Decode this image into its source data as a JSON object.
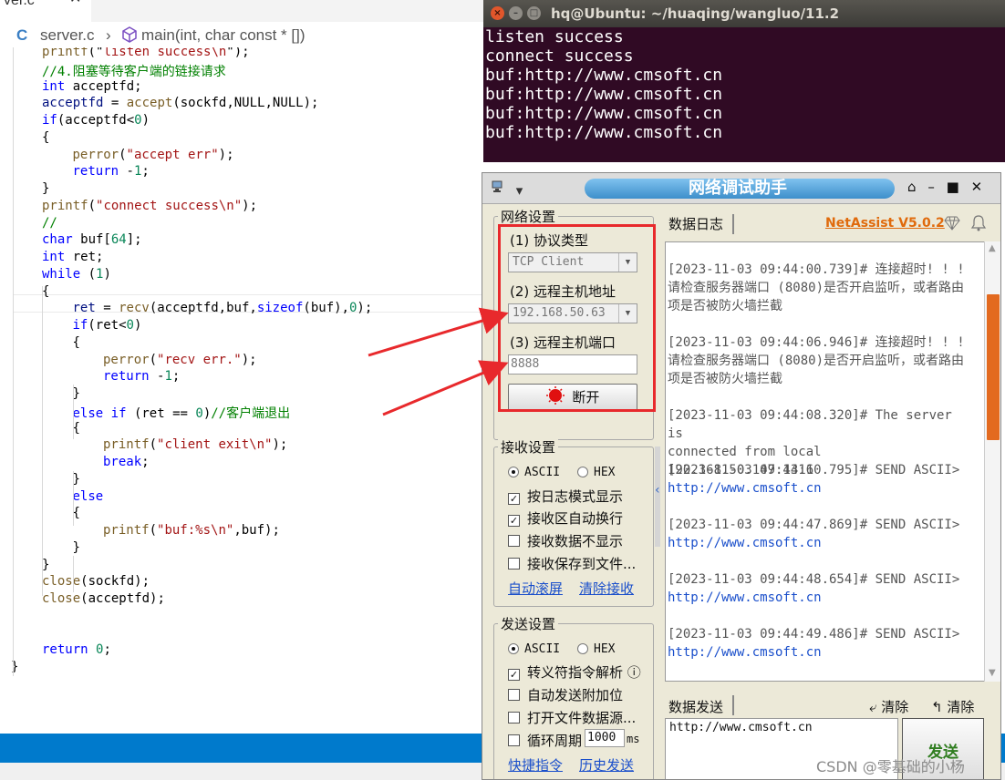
{
  "editor": {
    "tab": {
      "name": "ver.c",
      "close": "✕"
    },
    "breadcrumb": {
      "lang_icon": "C",
      "file": "server.c",
      "sep": "›",
      "symbol_icon": "cube-icon",
      "symbol": "main(int, char const * [])"
    },
    "current_line": 12,
    "lines": [
      {
        "indent": 1,
        "tokens": [
          [
            "fn",
            "printf"
          ],
          [
            "",
            "(\""
          ],
          [
            "str",
            "listen success\\n"
          ],
          [
            "",
            "\");"
          ]
        ]
      },
      {
        "indent": 1,
        "tokens": [
          [
            "cm",
            "//4.阻塞等待客户端的链接请求"
          ]
        ]
      },
      {
        "indent": 1,
        "tokens": [
          [
            "ty",
            "int"
          ],
          [
            "",
            " acceptfd;"
          ]
        ]
      },
      {
        "indent": 1,
        "tokens": [
          [
            "var",
            "acceptfd"
          ],
          [
            "",
            " = "
          ],
          [
            "fn",
            "accept"
          ],
          [
            "",
            "(sockfd,NULL,NULL);"
          ]
        ]
      },
      {
        "indent": 1,
        "tokens": [
          [
            "kw",
            "if"
          ],
          [
            "",
            "(acceptfd<"
          ],
          [
            "num",
            "0"
          ],
          [
            "",
            ")"
          ]
        ]
      },
      {
        "indent": 1,
        "tokens": [
          [
            "",
            "{"
          ]
        ]
      },
      {
        "indent": 2,
        "tokens": [
          [
            "fn",
            "perror"
          ],
          [
            "",
            "("
          ],
          [
            "str",
            "\"accept err\""
          ],
          [
            "",
            ");"
          ]
        ]
      },
      {
        "indent": 2,
        "tokens": [
          [
            "kw",
            "return"
          ],
          [
            "",
            " -"
          ],
          [
            "num",
            "1"
          ],
          [
            "",
            ";"
          ]
        ]
      },
      {
        "indent": 1,
        "tokens": [
          [
            "",
            "}"
          ]
        ]
      },
      {
        "indent": 1,
        "tokens": [
          [
            "fn",
            "printf"
          ],
          [
            "",
            "("
          ],
          [
            "str",
            "\"connect success\\n\""
          ],
          [
            "",
            ");"
          ]
        ]
      },
      {
        "indent": 1,
        "tokens": [
          [
            "cm",
            "//"
          ]
        ]
      },
      {
        "indent": 1,
        "tokens": [
          [
            "ty",
            "char"
          ],
          [
            "",
            " buf["
          ],
          [
            "num",
            "64"
          ],
          [
            "",
            "];"
          ]
        ]
      },
      {
        "indent": 1,
        "tokens": [
          [
            "ty",
            "int"
          ],
          [
            "",
            " ret;"
          ]
        ]
      },
      {
        "indent": 1,
        "tokens": [
          [
            "kw",
            "while"
          ],
          [
            "",
            " ("
          ],
          [
            "num",
            "1"
          ],
          [
            "",
            ")"
          ]
        ]
      },
      {
        "indent": 1,
        "tokens": [
          [
            "",
            "{"
          ]
        ]
      },
      {
        "indent": 2,
        "tokens": [
          [
            "var",
            "ret"
          ],
          [
            "",
            " = "
          ],
          [
            "fn",
            "recv"
          ],
          [
            "",
            "(acceptfd,buf,"
          ],
          [
            "kw",
            "sizeof"
          ],
          [
            "",
            "(buf),"
          ],
          [
            "num",
            "0"
          ],
          [
            "",
            ");"
          ]
        ]
      },
      {
        "indent": 2,
        "tokens": [
          [
            "kw",
            "if"
          ],
          [
            "",
            "(ret<"
          ],
          [
            "num",
            "0"
          ],
          [
            "",
            ")"
          ]
        ]
      },
      {
        "indent": 2,
        "tokens": [
          [
            "",
            "{"
          ]
        ]
      },
      {
        "indent": 3,
        "tokens": [
          [
            "fn",
            "perror"
          ],
          [
            "",
            "("
          ],
          [
            "str",
            "\"recv err.\""
          ],
          [
            "",
            ");"
          ]
        ]
      },
      {
        "indent": 3,
        "tokens": [
          [
            "kw",
            "return"
          ],
          [
            "",
            " -"
          ],
          [
            "num",
            "1"
          ],
          [
            "",
            ";"
          ]
        ]
      },
      {
        "indent": 2,
        "tokens": [
          [
            "",
            "}"
          ]
        ]
      },
      {
        "indent": 2,
        "tokens": [
          [
            "kw",
            "else if"
          ],
          [
            "",
            " (ret == "
          ],
          [
            "num",
            "0"
          ],
          [
            "",
            ")"
          ],
          [
            "cm",
            "//客户端退出"
          ]
        ]
      },
      {
        "indent": 2,
        "tokens": [
          [
            "",
            "{"
          ]
        ]
      },
      {
        "indent": 3,
        "tokens": [
          [
            "fn",
            "printf"
          ],
          [
            "",
            "("
          ],
          [
            "str",
            "\"client exit\\n\""
          ],
          [
            "",
            ");"
          ]
        ]
      },
      {
        "indent": 3,
        "tokens": [
          [
            "kw",
            "break"
          ],
          [
            "",
            ";"
          ]
        ]
      },
      {
        "indent": 2,
        "tokens": [
          [
            "",
            "}"
          ]
        ]
      },
      {
        "indent": 2,
        "tokens": [
          [
            "kw",
            "else"
          ]
        ]
      },
      {
        "indent": 2,
        "tokens": [
          [
            "",
            "{"
          ]
        ]
      },
      {
        "indent": 3,
        "tokens": [
          [
            "fn",
            "printf"
          ],
          [
            "",
            "("
          ],
          [
            "str",
            "\"buf:%s\\n\""
          ],
          [
            "",
            ",buf);"
          ]
        ]
      },
      {
        "indent": 2,
        "tokens": [
          [
            "",
            "}"
          ]
        ]
      },
      {
        "indent": 1,
        "tokens": [
          [
            "",
            "}"
          ]
        ]
      },
      {
        "indent": 1,
        "tokens": [
          [
            "fn",
            "close"
          ],
          [
            "",
            "(sockfd);"
          ]
        ]
      },
      {
        "indent": 1,
        "tokens": [
          [
            "fn",
            "close"
          ],
          [
            "",
            "(acceptfd);"
          ]
        ]
      },
      {
        "indent": 0,
        "tokens": []
      },
      {
        "indent": 0,
        "tokens": []
      },
      {
        "indent": 1,
        "tokens": [
          [
            "kw",
            "return"
          ],
          [
            "",
            " "
          ],
          [
            "num",
            "0"
          ],
          [
            "",
            ";"
          ]
        ]
      },
      {
        "indent": 0,
        "tokens": [
          [
            "",
            "}"
          ]
        ]
      }
    ]
  },
  "terminal": {
    "title": "hq@Ubuntu: ~/huaqing/wangluo/11.2",
    "buttons": [
      "×",
      "–",
      "□"
    ],
    "lines": [
      "listen success",
      "connect success",
      "buf:http://www.cmsoft.cn",
      "buf:http://www.cmsoft.cn",
      "buf:http://www.cmsoft.cn",
      "buf:http://www.cmsoft.cn"
    ]
  },
  "netassist": {
    "title": "网络调试助手",
    "menu_icon": "▾",
    "window_buttons": [
      "⌂",
      "–",
      "■",
      "✕"
    ],
    "net_settings": {
      "title": "网络设置",
      "protocol_label": "(1) 协议类型",
      "protocol_value": "TCP Client",
      "host_label": "(2) 远程主机地址",
      "host_value": "192.168.50.63",
      "port_label": "(3) 远程主机端口",
      "port_value": "8888",
      "disconnect_label": "断开"
    },
    "recv_settings": {
      "title": "接收设置",
      "ascii": "ASCII",
      "hex": "HEX",
      "opt_log_mode": "按日志模式显示",
      "opt_auto_wrap": "接收区自动换行",
      "opt_no_display": "接收数据不显示",
      "opt_save_file": "接收保存到文件...",
      "link_autoscroll": "自动滚屏",
      "link_clear": "清除接收"
    },
    "send_settings": {
      "title": "发送设置",
      "ascii": "ASCII",
      "hex": "HEX",
      "opt_escape": "转义符指令解析",
      "info_icon": "ⓘ",
      "opt_append": "自动发送附加位",
      "opt_open_file": "打开文件数据源...",
      "opt_cycle": "循环周期",
      "cycle_value": "1000",
      "cycle_unit": "ms",
      "link_shortcut": "快捷指令",
      "link_history": "历史发送"
    },
    "log": {
      "tab": "数据日志",
      "brand": "NetAssist V5.0.2",
      "entries": [
        {
          "head": "[2023-11-03 09:44:00.739]# 连接超时! ! !",
          "body": "请检查服务器端口 (8080)是否开启监听，或者路由项是否被防火墙拦截",
          "url": ""
        },
        {
          "head": "[2023-11-03 09:44:06.946]# 连接超时! ! !",
          "body": "请检查服务器端口 (8080)是否开启监听，或者路由项是否被防火墙拦截",
          "url": ""
        },
        {
          "head": "[2023-11-03 09:44:08.320]# The server is",
          "body": "connected from local 192.168.50.147:1316",
          "url": ""
        },
        {
          "head": "[2023-11-03 09:44:10.795]# SEND ASCII>",
          "body": "",
          "url": "http://www.cmsoft.cn"
        },
        {
          "head": "[2023-11-03 09:44:47.869]# SEND ASCII>",
          "body": "",
          "url": "http://www.cmsoft.cn"
        },
        {
          "head": "[2023-11-03 09:44:48.654]# SEND ASCII>",
          "body": "",
          "url": "http://www.cmsoft.cn"
        },
        {
          "head": "[2023-11-03 09:44:49.486]# SEND ASCII>",
          "body": "",
          "url": "http://www.cmsoft.cn"
        }
      ]
    },
    "send": {
      "tab": "数据发送",
      "clear1": "清除",
      "clear2": "清除",
      "input_value": "http://www.cmsoft.cn",
      "send_label": "发送"
    },
    "colors": {
      "highlight_box": "#e8292c",
      "brand": "#e06a0c",
      "title_pill": "#3d8fcb"
    }
  },
  "watermark": "CSDN @零基础的小杨"
}
